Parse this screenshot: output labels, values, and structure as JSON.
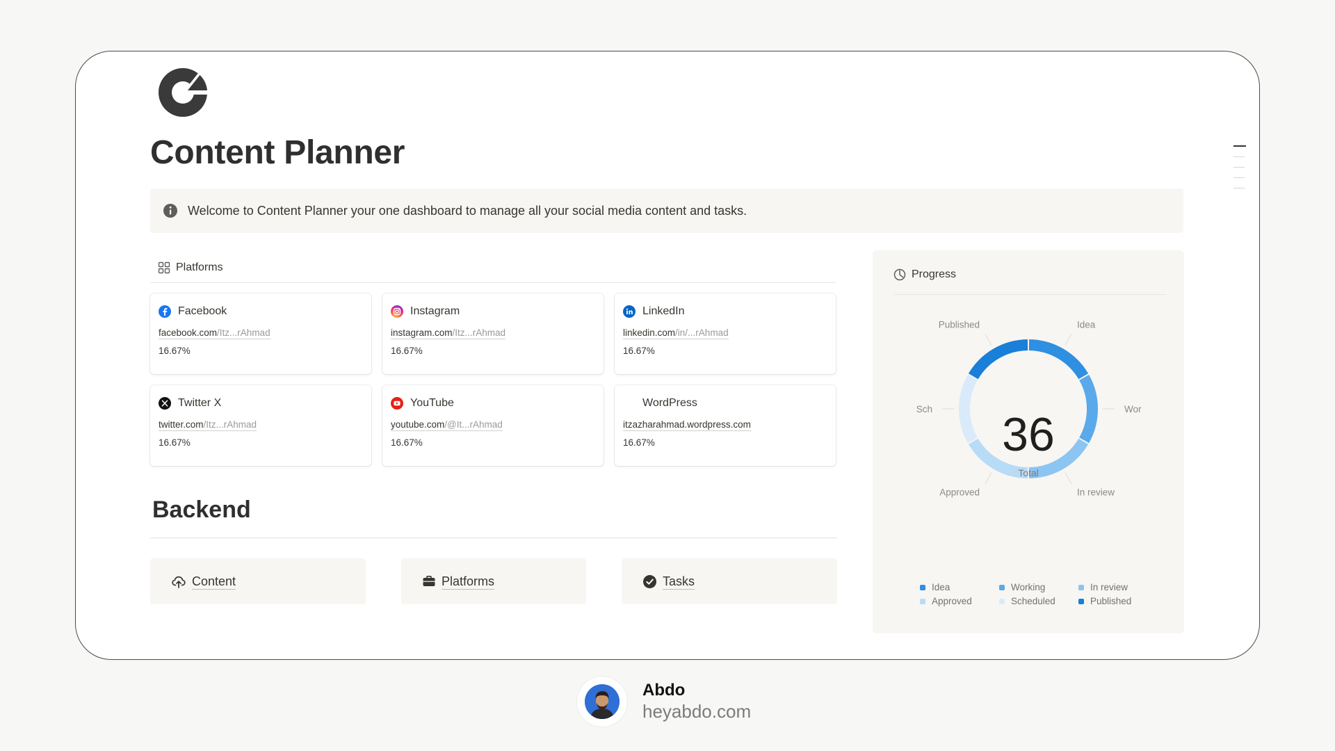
{
  "page": {
    "title": "Content Planner",
    "callout_text": "Welcome to Content Planner your one dashboard to manage all your social media content and tasks."
  },
  "platforms": {
    "heading": "Platforms",
    "items": [
      {
        "name": "Facebook",
        "url_main": "facebook.com",
        "url_rest": "/Itz...rAhmad",
        "share": "16.67%",
        "icon": "facebook-icon",
        "color": "#1877f2"
      },
      {
        "name": "Instagram",
        "url_main": "instagram.com",
        "url_rest": "/Itz...rAhmad",
        "share": "16.67%",
        "icon": "instagram-icon",
        "color": "#e1306c"
      },
      {
        "name": "LinkedIn",
        "url_main": "linkedin.com",
        "url_rest": "/in/...rAhmad",
        "share": "16.67%",
        "icon": "linkedin-icon",
        "color": "#0a66c2"
      },
      {
        "name": "Twitter X",
        "url_main": "twitter.com",
        "url_rest": "/Itz...rAhmad",
        "share": "16.67%",
        "icon": "x-icon",
        "color": "#111111"
      },
      {
        "name": "YouTube",
        "url_main": "youtube.com",
        "url_rest": "/@It...rAhmad",
        "share": "16.67%",
        "icon": "youtube-icon",
        "color": "#e62117"
      },
      {
        "name": "WordPress",
        "url_main": "itzazharahmad.wordpress.com",
        "url_rest": "",
        "share": "16.67%",
        "icon": "",
        "color": ""
      }
    ]
  },
  "backend": {
    "title": "Backend",
    "buttons": [
      {
        "label": "Content",
        "icon": "cloud-upload-icon"
      },
      {
        "label": "Platforms",
        "icon": "briefcase-icon"
      },
      {
        "label": "Tasks",
        "icon": "check-circle-icon"
      }
    ]
  },
  "progress": {
    "heading": "Progress",
    "total": "36",
    "total_label": "Total",
    "outer_labels": {
      "published": "Published",
      "idea": "Idea",
      "sch": "Sch",
      "wor": "Wor",
      "approved": "Approved",
      "in_review": "In review"
    },
    "legend": [
      {
        "label": "Idea",
        "color": "#2f8fe0"
      },
      {
        "label": "Working",
        "color": "#5aa9ea"
      },
      {
        "label": "In review",
        "color": "#8cc4f2"
      },
      {
        "label": "Approved",
        "color": "#b8dbf6"
      },
      {
        "label": "Scheduled",
        "color": "#d9ebfa"
      },
      {
        "label": "Published",
        "color": "#1a7fd8"
      }
    ]
  },
  "chart_data": {
    "type": "pie",
    "title": "",
    "total": 36,
    "total_label": "Total",
    "categories": [
      "Idea",
      "Working",
      "In review",
      "Approved",
      "Scheduled",
      "Published"
    ],
    "values": [
      6,
      6,
      6,
      6,
      6,
      6
    ],
    "colors": [
      "#2f8fe0",
      "#5aa9ea",
      "#8cc4f2",
      "#b8dbf6",
      "#d9ebfa",
      "#1a7fd8"
    ],
    "legend": "bottom"
  },
  "author": {
    "name": "Abdo",
    "site": "heyabdo.com"
  }
}
